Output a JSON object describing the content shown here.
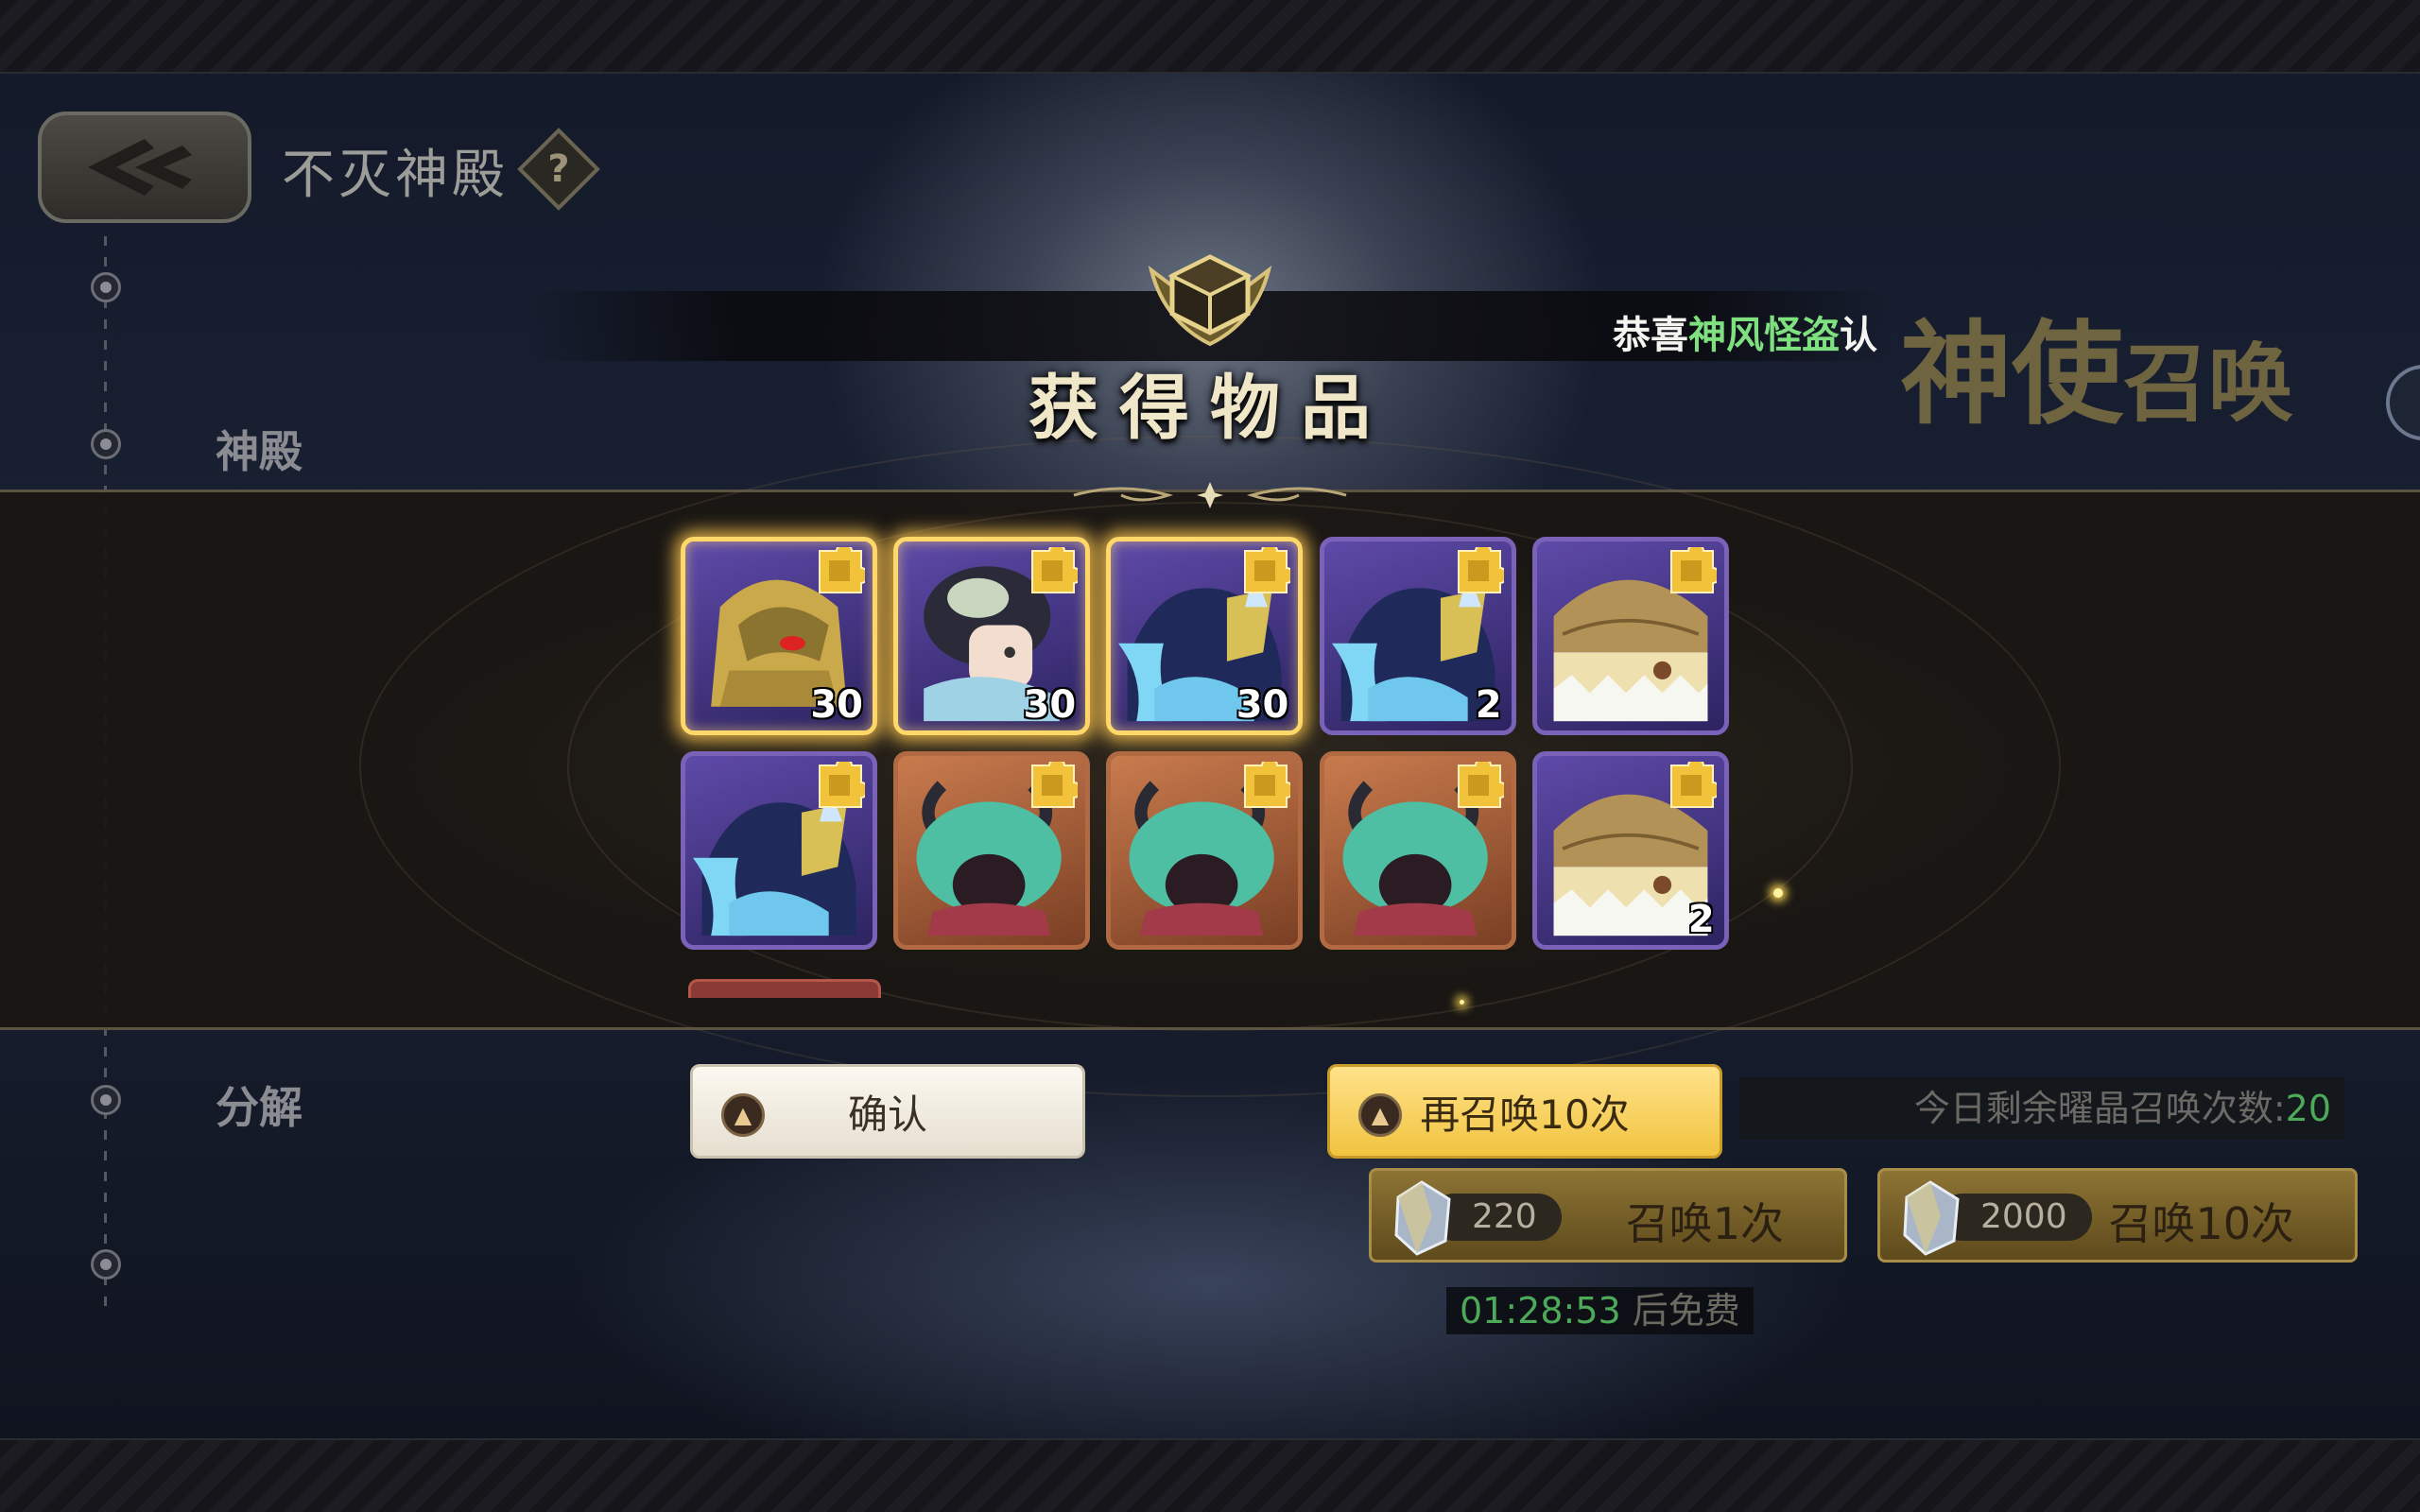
{
  "header": {
    "title": "不灭神殿",
    "help_icon": "?"
  },
  "sidebar": {
    "items": [
      {
        "label": "神殿"
      },
      {
        "label": "分解"
      }
    ]
  },
  "announcement": {
    "prefix": "恭喜",
    "highlight": "神风怪盗",
    "cut": "认"
  },
  "summon_section_title": {
    "big": "神使",
    "small": "召唤"
  },
  "reward_dialog": {
    "title": "获得物品",
    "items": [
      {
        "character": "golden-armored-warrior",
        "frame": "purple",
        "glow": true,
        "count": "30"
      },
      {
        "character": "dark-haired-lady",
        "frame": "purple",
        "glow": true,
        "count": "30"
      },
      {
        "character": "masked-blue-dragon",
        "frame": "purple",
        "glow": true,
        "count": "30"
      },
      {
        "character": "masked-blue-dragon",
        "frame": "purple",
        "glow": false,
        "count": "2"
      },
      {
        "character": "straw-hat-egg",
        "frame": "purple",
        "glow": false,
        "count": ""
      },
      {
        "character": "masked-blue-dragon",
        "frame": "purple",
        "glow": false,
        "count": ""
      },
      {
        "character": "horned-teal-hair-girl",
        "frame": "orange",
        "glow": false,
        "count": ""
      },
      {
        "character": "horned-teal-hair-girl",
        "frame": "orange",
        "glow": false,
        "count": ""
      },
      {
        "character": "horned-teal-hair-girl",
        "frame": "orange",
        "glow": false,
        "count": ""
      },
      {
        "character": "straw-hat-egg",
        "frame": "purple",
        "glow": false,
        "count": "2"
      }
    ],
    "confirm_label": "确认",
    "again_label": "再召唤10次"
  },
  "remaining": {
    "label": "今日剩余曜晶召唤次数:",
    "value": "20"
  },
  "summon_buttons": [
    {
      "cost": "220",
      "label": "召唤1次"
    },
    {
      "cost": "2000",
      "label": "召唤10次"
    }
  ],
  "free_timer": {
    "time": "01:28:53",
    "suffix": "后免费"
  },
  "colors": {
    "accent_gold": "#f1c440",
    "rare_purple": "#7a62b8",
    "common_orange": "#b26a42",
    "highlight_green": "#7ee07e"
  }
}
